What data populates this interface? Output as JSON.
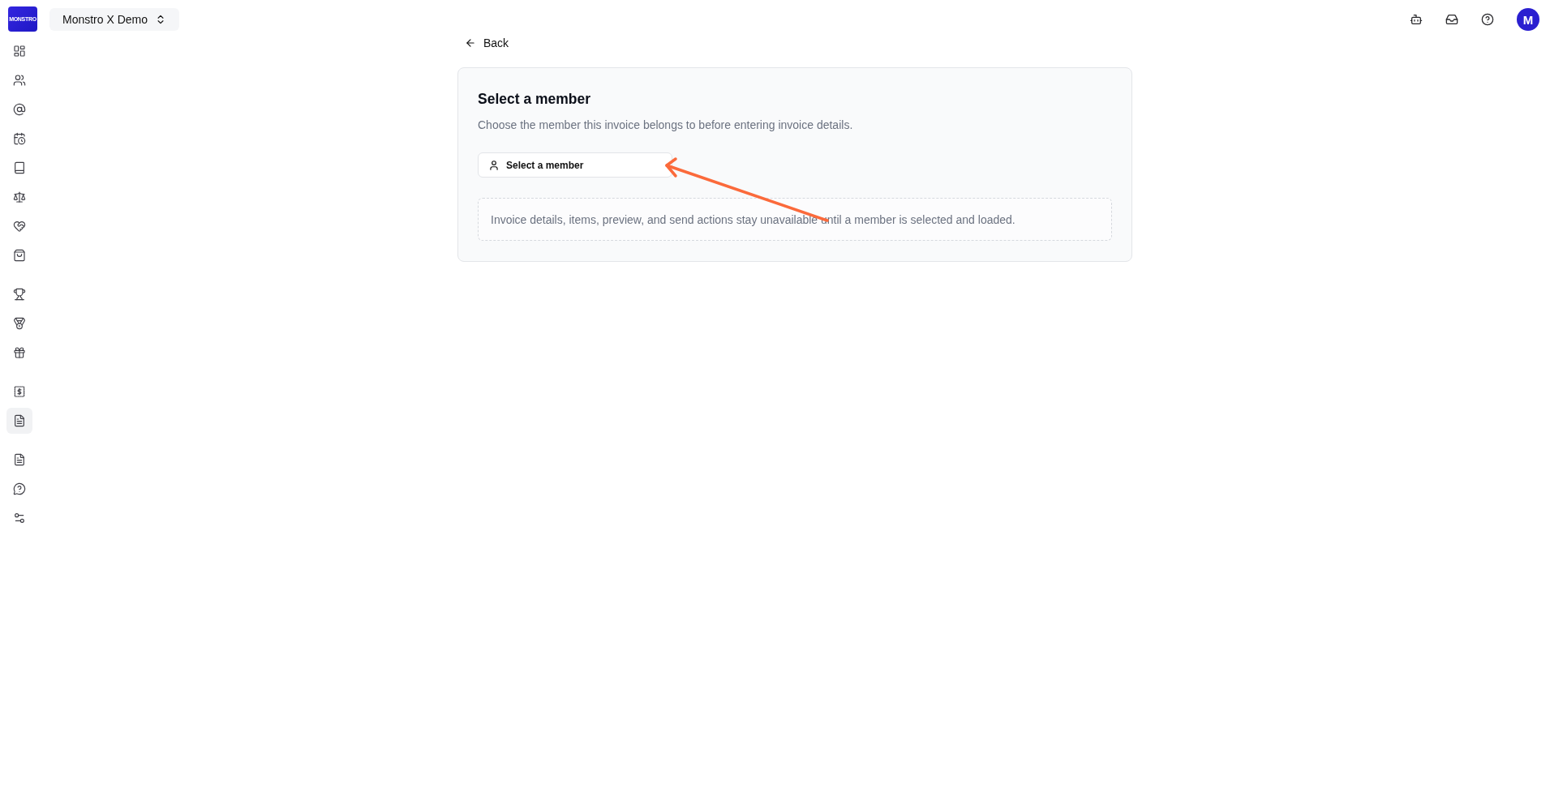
{
  "sidebar": {
    "logo": "MONSTRO",
    "groups": [
      {
        "items": [
          {
            "selected": false
          },
          {
            "selected": false
          },
          {
            "selected": false
          },
          {
            "selected": false
          },
          {
            "selected": false
          },
          {
            "selected": false
          },
          {
            "selected": false
          },
          {
            "selected": false
          }
        ]
      },
      {
        "items": [
          {
            "selected": false
          },
          {
            "selected": false
          },
          {
            "selected": false
          }
        ]
      },
      {
        "items": [
          {
            "selected": false
          },
          {
            "selected": true
          }
        ]
      },
      {
        "items": [
          {
            "selected": false
          },
          {
            "selected": false
          },
          {
            "selected": false
          }
        ]
      }
    ]
  },
  "header": {
    "workspace": "Monstro X Demo",
    "avatar_initial": "M"
  },
  "back_link": "Back",
  "card": {
    "title": "Select a member",
    "description": "Choose the member this invoice belongs to before entering invoice details.",
    "member_button": "Select a member",
    "notice": "Invoice details, items, preview, and send actions stay unavailable until a member is selected and loaded."
  },
  "annotations": [
    {
      "kind": "arrow"
    }
  ]
}
